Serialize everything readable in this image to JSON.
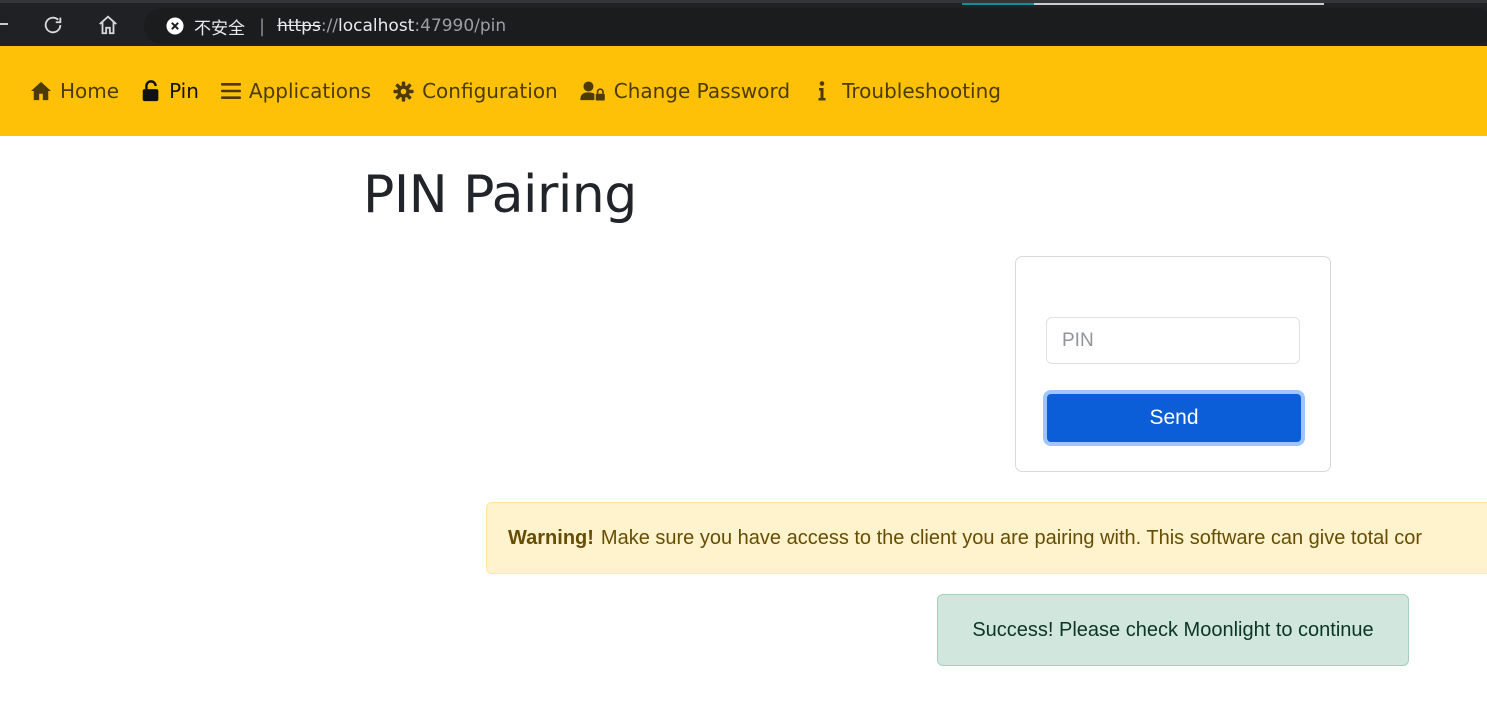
{
  "browser": {
    "security_label": "不安全",
    "url_scheme": "https",
    "url_sep": "://",
    "url_host": "localhost",
    "url_path": ":47990/pin",
    "icons": [
      "back-icon",
      "reload-icon",
      "home-icon",
      "insecure-icon"
    ]
  },
  "navbar": {
    "items": [
      {
        "label": "Home",
        "icon": "home-icon"
      },
      {
        "label": "Pin",
        "icon": "unlock-icon",
        "active": true
      },
      {
        "label": "Applications",
        "icon": "list-icon"
      },
      {
        "label": "Configuration",
        "icon": "gear-icon"
      },
      {
        "label": "Change Password",
        "icon": "user-lock-icon"
      },
      {
        "label": "Troubleshooting",
        "icon": "info-icon"
      }
    ],
    "background": "#ffc107"
  },
  "main": {
    "title": "PIN Pairing",
    "pin_form": {
      "placeholder": "PIN",
      "value": "",
      "send_label": "Send"
    },
    "warning": {
      "strong": "Warning!",
      "text": "Make sure you have access to the client you are pairing with. This software can give total cor"
    },
    "success": {
      "text": "Success! Please check Moonlight to continue"
    }
  },
  "colors": {
    "primary": "#0b5ed7",
    "warning_bg": "#fff3cd",
    "success_bg": "#d1e7dd"
  }
}
